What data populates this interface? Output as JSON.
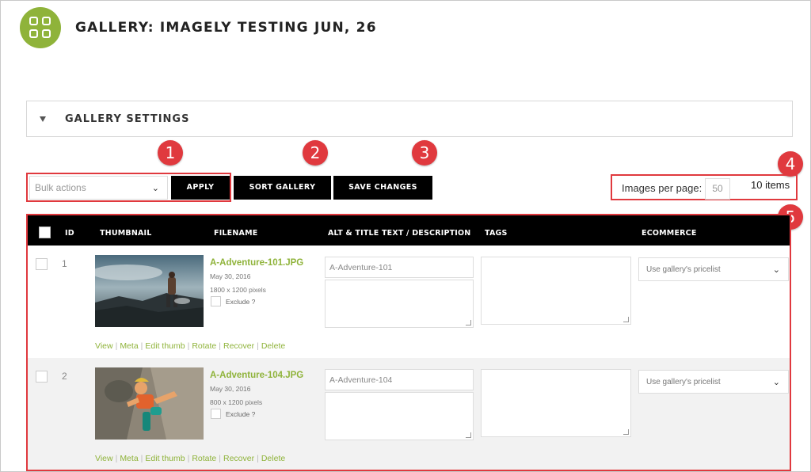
{
  "header": {
    "title": "GALLERY: IMAGELY TESTING JUN, 26",
    "logo_icon": "grid-icon",
    "accent": "#8fb33a"
  },
  "settings": {
    "label": "GALLERY SETTINGS"
  },
  "toolbar": {
    "bulk_placeholder": "Bulk actions",
    "apply_label": "APPLY",
    "sort_label": "SORT GALLERY",
    "save_label": "SAVE CHANGES",
    "images_per_page_label": "Images per page:",
    "images_per_page_value": "50",
    "items_count": "10 items"
  },
  "badges": [
    "1",
    "2",
    "3",
    "4",
    "5"
  ],
  "badge_color": "#e0393e",
  "table": {
    "columns": {
      "id": "ID",
      "thumbnail": "THUMBNAIL",
      "filename": "FILENAME",
      "alt": "ALT & TITLE TEXT / DESCRIPTION",
      "tags": "TAGS",
      "ecommerce": "ECOMMERCE"
    },
    "rows": [
      {
        "id": "1",
        "filename": "A-Adventure-101.JPG",
        "date": "May 30, 2016",
        "dimensions": "1800 x 1200 pixels",
        "exclude": "Exclude ?",
        "alt": "A-Adventure-101",
        "pricelist": "Use gallery's pricelist"
      },
      {
        "id": "2",
        "filename": "A-Adventure-104.JPG",
        "date": "May 30, 2016",
        "dimensions": "800 x 1200 pixels",
        "exclude": "Exclude ?",
        "alt": "A-Adventure-104",
        "pricelist": "Use gallery's pricelist"
      }
    ],
    "row_actions": [
      "View",
      "Meta",
      "Edit thumb",
      "Rotate",
      "Recover",
      "Delete"
    ]
  }
}
